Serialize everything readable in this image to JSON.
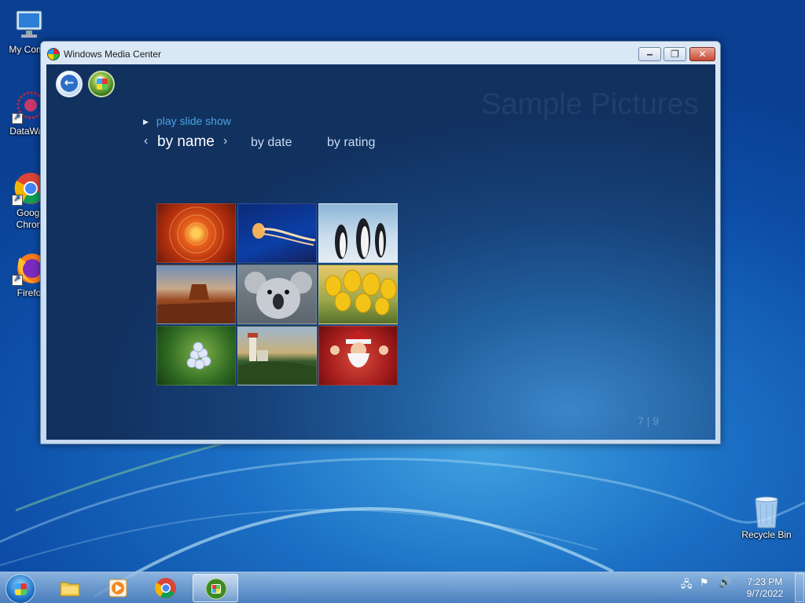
{
  "desktop": {
    "icons": [
      {
        "label": "My Comp"
      },
      {
        "label": "DataWag"
      },
      {
        "label": "Googl Chron"
      },
      {
        "label": "Firefo"
      },
      {
        "label": "Recycle Bin"
      }
    ]
  },
  "window": {
    "title": "Windows Media Center",
    "minimize_glyph": "‒",
    "maximize_glyph": "❐",
    "close_glyph": "✕"
  },
  "media_center": {
    "background_title": "Sample Pictures",
    "play_slide_show": "play slide show",
    "sort": {
      "prev_chevron": "‹",
      "next_chevron": "›",
      "active": "by name",
      "options": [
        "by date",
        "by rating"
      ]
    },
    "pictures": [
      {
        "subject": "chrysanthemum"
      },
      {
        "subject": "jellyfish"
      },
      {
        "subject": "penguins"
      },
      {
        "subject": "desert"
      },
      {
        "subject": "koala"
      },
      {
        "subject": "tulips"
      },
      {
        "subject": "hydrangeas"
      },
      {
        "subject": "lighthouse"
      },
      {
        "subject": "santa"
      }
    ],
    "counter": {
      "current": "7",
      "separator": "|",
      "total": "9"
    },
    "transport": {
      "icons": [
        "record-icon",
        "guide-icon",
        "channel-down-icon",
        "channel-up-icon",
        "stop-icon",
        "rewind-icon",
        "skip-back-icon",
        "play-icon",
        "skip-forward-icon",
        "fast-forward-icon",
        "mute-icon",
        "volume-down-icon",
        "volume-up-icon"
      ]
    }
  },
  "taskbar": {
    "clock_time": "7:23 PM",
    "clock_date": "9/7/2022"
  },
  "colors": {
    "accent_link": "#4aa3e4",
    "client_dark": "#11315f"
  }
}
